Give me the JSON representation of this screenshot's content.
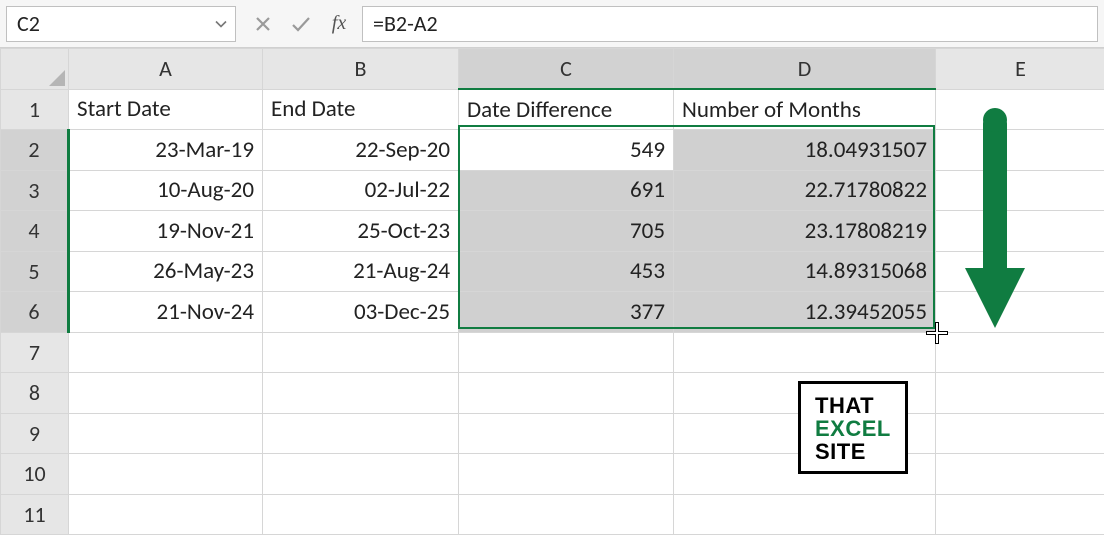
{
  "formula_bar": {
    "name_box": "C2",
    "formula": "=B2-A2",
    "fx_label": "fx"
  },
  "columns": {
    "A": "A",
    "B": "B",
    "C": "C",
    "D": "D",
    "E": "E"
  },
  "rows": {
    "r1": "1",
    "r2": "2",
    "r3": "3",
    "r4": "4",
    "r5": "5",
    "r6": "6",
    "r7": "7",
    "r8": "8",
    "r9": "9",
    "r10": "10",
    "r11": "11"
  },
  "headers": {
    "A": "Start Date",
    "B": "End Date",
    "C": "Date Difference",
    "D": "Number of Months"
  },
  "data": {
    "r2": {
      "A": "23-Mar-19",
      "B": "22-Sep-20",
      "C": "549",
      "D": "18.04931507"
    },
    "r3": {
      "A": "10-Aug-20",
      "B": "02-Jul-22",
      "C": "691",
      "D": "22.71780822"
    },
    "r4": {
      "A": "19-Nov-21",
      "B": "25-Oct-23",
      "C": "705",
      "D": "23.17808219"
    },
    "r5": {
      "A": "26-May-23",
      "B": "21-Aug-24",
      "C": "453",
      "D": "14.89315068"
    },
    "r6": {
      "A": "21-Nov-24",
      "B": "03-Dec-25",
      "C": "377",
      "D": "12.39452055"
    }
  },
  "logo": {
    "l1": "THAT",
    "l2": "EXCEL",
    "l3": "SITE"
  },
  "chart_data": {
    "type": "table",
    "title": "",
    "columns": [
      "Start Date",
      "End Date",
      "Date Difference",
      "Number of Months"
    ],
    "rows": [
      [
        "23-Mar-19",
        "22-Sep-20",
        549,
        18.04931507
      ],
      [
        "10-Aug-20",
        "02-Jul-22",
        691,
        22.71780822
      ],
      [
        "19-Nov-21",
        "25-Oct-23",
        705,
        23.17808219
      ],
      [
        "26-May-23",
        "21-Aug-24",
        453,
        14.89315068
      ],
      [
        "21-Nov-24",
        "03-Dec-25",
        377,
        12.39452055
      ]
    ]
  }
}
